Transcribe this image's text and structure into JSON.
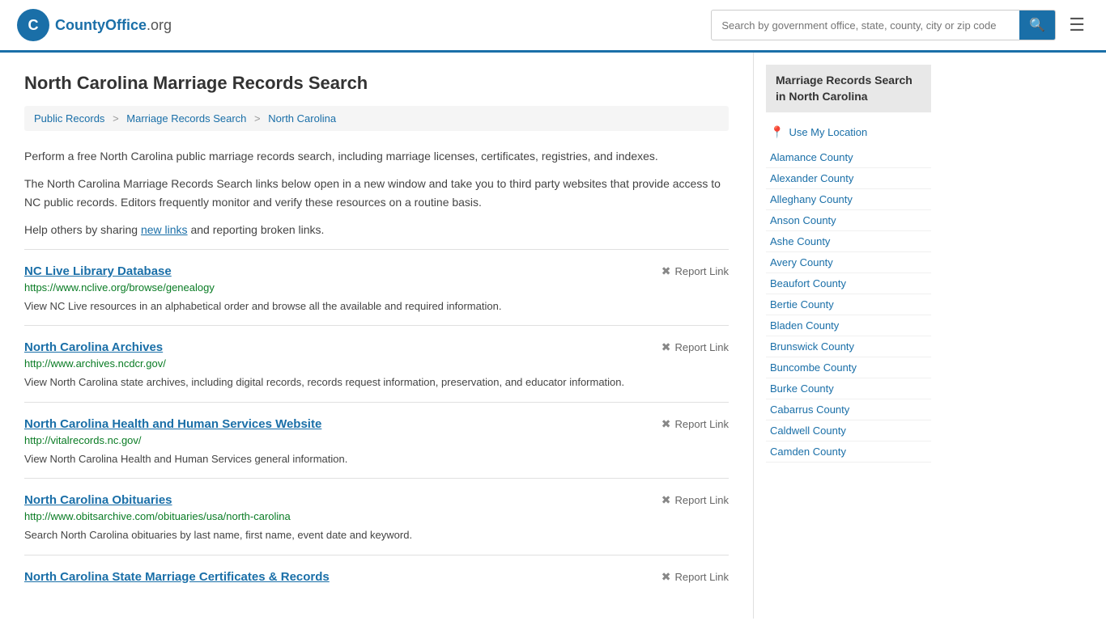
{
  "header": {
    "logo_text": "CountyOffice",
    "logo_suffix": ".org",
    "search_placeholder": "Search by government office, state, county, city or zip code",
    "search_button_icon": "🔍"
  },
  "breadcrumb": {
    "items": [
      {
        "label": "Public Records",
        "href": "#"
      },
      {
        "label": "Marriage Records Search",
        "href": "#"
      },
      {
        "label": "North Carolina",
        "href": "#"
      }
    ]
  },
  "page": {
    "title": "North Carolina Marriage Records Search",
    "description1": "Perform a free North Carolina public marriage records search, including marriage licenses, certificates, registries, and indexes.",
    "description2": "The North Carolina Marriage Records Search links below open in a new window and take you to third party websites that provide access to NC public records. Editors frequently monitor and verify these resources on a routine basis.",
    "description3_pre": "Help others by sharing ",
    "description3_link": "new links",
    "description3_post": " and reporting broken links."
  },
  "results": [
    {
      "title": "NC Live Library Database",
      "url": "https://www.nclive.org/browse/genealogy",
      "description": "View NC Live resources in an alphabetical order and browse all the available and required information.",
      "report_label": "Report Link"
    },
    {
      "title": "North Carolina Archives",
      "url": "http://www.archives.ncdcr.gov/",
      "description": "View North Carolina state archives, including digital records, records request information, preservation, and educator information.",
      "report_label": "Report Link"
    },
    {
      "title": "North Carolina Health and Human Services Website",
      "url": "http://vitalrecords.nc.gov/",
      "description": "View North Carolina Health and Human Services general information.",
      "report_label": "Report Link"
    },
    {
      "title": "North Carolina Obituaries",
      "url": "http://www.obitsarchive.com/obituaries/usa/north-carolina",
      "description": "Search North Carolina obituaries by last name, first name, event date and keyword.",
      "report_label": "Report Link"
    },
    {
      "title": "North Carolina State Marriage Certificates & Records",
      "url": "",
      "description": "",
      "report_label": "Report Link"
    }
  ],
  "sidebar": {
    "title": "Marriage Records Search in North Carolina",
    "use_location_label": "Use My Location",
    "counties": [
      "Alamance County",
      "Alexander County",
      "Alleghany County",
      "Anson County",
      "Ashe County",
      "Avery County",
      "Beaufort County",
      "Bertie County",
      "Bladen County",
      "Brunswick County",
      "Buncombe County",
      "Burke County",
      "Cabarrus County",
      "Caldwell County",
      "Camden County"
    ]
  }
}
